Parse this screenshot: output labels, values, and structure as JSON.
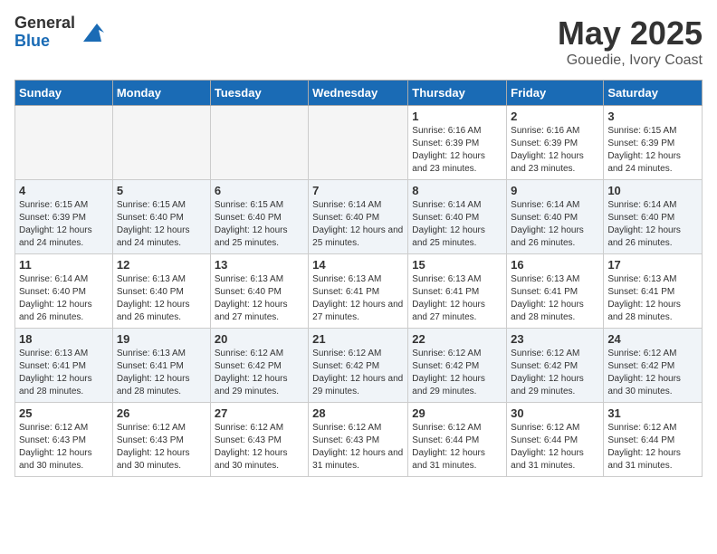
{
  "logo": {
    "general": "General",
    "blue": "Blue"
  },
  "title": {
    "month_year": "May 2025",
    "location": "Gouedie, Ivory Coast"
  },
  "days_of_week": [
    "Sunday",
    "Monday",
    "Tuesday",
    "Wednesday",
    "Thursday",
    "Friday",
    "Saturday"
  ],
  "weeks": [
    [
      {
        "day": "",
        "info": ""
      },
      {
        "day": "",
        "info": ""
      },
      {
        "day": "",
        "info": ""
      },
      {
        "day": "",
        "info": ""
      },
      {
        "day": "1",
        "info": "Sunrise: 6:16 AM\nSunset: 6:39 PM\nDaylight: 12 hours and 23 minutes."
      },
      {
        "day": "2",
        "info": "Sunrise: 6:16 AM\nSunset: 6:39 PM\nDaylight: 12 hours and 23 minutes."
      },
      {
        "day": "3",
        "info": "Sunrise: 6:15 AM\nSunset: 6:39 PM\nDaylight: 12 hours and 24 minutes."
      }
    ],
    [
      {
        "day": "4",
        "info": "Sunrise: 6:15 AM\nSunset: 6:39 PM\nDaylight: 12 hours and 24 minutes."
      },
      {
        "day": "5",
        "info": "Sunrise: 6:15 AM\nSunset: 6:40 PM\nDaylight: 12 hours and 24 minutes."
      },
      {
        "day": "6",
        "info": "Sunrise: 6:15 AM\nSunset: 6:40 PM\nDaylight: 12 hours and 25 minutes."
      },
      {
        "day": "7",
        "info": "Sunrise: 6:14 AM\nSunset: 6:40 PM\nDaylight: 12 hours and 25 minutes."
      },
      {
        "day": "8",
        "info": "Sunrise: 6:14 AM\nSunset: 6:40 PM\nDaylight: 12 hours and 25 minutes."
      },
      {
        "day": "9",
        "info": "Sunrise: 6:14 AM\nSunset: 6:40 PM\nDaylight: 12 hours and 26 minutes."
      },
      {
        "day": "10",
        "info": "Sunrise: 6:14 AM\nSunset: 6:40 PM\nDaylight: 12 hours and 26 minutes."
      }
    ],
    [
      {
        "day": "11",
        "info": "Sunrise: 6:14 AM\nSunset: 6:40 PM\nDaylight: 12 hours and 26 minutes."
      },
      {
        "day": "12",
        "info": "Sunrise: 6:13 AM\nSunset: 6:40 PM\nDaylight: 12 hours and 26 minutes."
      },
      {
        "day": "13",
        "info": "Sunrise: 6:13 AM\nSunset: 6:40 PM\nDaylight: 12 hours and 27 minutes."
      },
      {
        "day": "14",
        "info": "Sunrise: 6:13 AM\nSunset: 6:41 PM\nDaylight: 12 hours and 27 minutes."
      },
      {
        "day": "15",
        "info": "Sunrise: 6:13 AM\nSunset: 6:41 PM\nDaylight: 12 hours and 27 minutes."
      },
      {
        "day": "16",
        "info": "Sunrise: 6:13 AM\nSunset: 6:41 PM\nDaylight: 12 hours and 28 minutes."
      },
      {
        "day": "17",
        "info": "Sunrise: 6:13 AM\nSunset: 6:41 PM\nDaylight: 12 hours and 28 minutes."
      }
    ],
    [
      {
        "day": "18",
        "info": "Sunrise: 6:13 AM\nSunset: 6:41 PM\nDaylight: 12 hours and 28 minutes."
      },
      {
        "day": "19",
        "info": "Sunrise: 6:13 AM\nSunset: 6:41 PM\nDaylight: 12 hours and 28 minutes."
      },
      {
        "day": "20",
        "info": "Sunrise: 6:12 AM\nSunset: 6:42 PM\nDaylight: 12 hours and 29 minutes."
      },
      {
        "day": "21",
        "info": "Sunrise: 6:12 AM\nSunset: 6:42 PM\nDaylight: 12 hours and 29 minutes."
      },
      {
        "day": "22",
        "info": "Sunrise: 6:12 AM\nSunset: 6:42 PM\nDaylight: 12 hours and 29 minutes."
      },
      {
        "day": "23",
        "info": "Sunrise: 6:12 AM\nSunset: 6:42 PM\nDaylight: 12 hours and 29 minutes."
      },
      {
        "day": "24",
        "info": "Sunrise: 6:12 AM\nSunset: 6:42 PM\nDaylight: 12 hours and 30 minutes."
      }
    ],
    [
      {
        "day": "25",
        "info": "Sunrise: 6:12 AM\nSunset: 6:43 PM\nDaylight: 12 hours and 30 minutes."
      },
      {
        "day": "26",
        "info": "Sunrise: 6:12 AM\nSunset: 6:43 PM\nDaylight: 12 hours and 30 minutes."
      },
      {
        "day": "27",
        "info": "Sunrise: 6:12 AM\nSunset: 6:43 PM\nDaylight: 12 hours and 30 minutes."
      },
      {
        "day": "28",
        "info": "Sunrise: 6:12 AM\nSunset: 6:43 PM\nDaylight: 12 hours and 31 minutes."
      },
      {
        "day": "29",
        "info": "Sunrise: 6:12 AM\nSunset: 6:44 PM\nDaylight: 12 hours and 31 minutes."
      },
      {
        "day": "30",
        "info": "Sunrise: 6:12 AM\nSunset: 6:44 PM\nDaylight: 12 hours and 31 minutes."
      },
      {
        "day": "31",
        "info": "Sunrise: 6:12 AM\nSunset: 6:44 PM\nDaylight: 12 hours and 31 minutes."
      }
    ]
  ]
}
